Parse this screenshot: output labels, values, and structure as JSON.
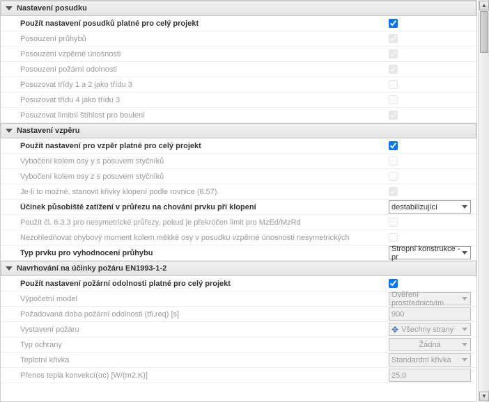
{
  "sections": [
    {
      "title": "Nastavení posudku",
      "rows": [
        {
          "label": "Použít nastavení posudků platné pro celý projekt",
          "type": "checkbox",
          "checked": true,
          "enabled": true,
          "bold": true
        },
        {
          "label": "Posouzení průhybů",
          "type": "checkbox",
          "checked": true,
          "enabled": false
        },
        {
          "label": "Posouzení vzpěrné únosnosti",
          "type": "checkbox",
          "checked": true,
          "enabled": false
        },
        {
          "label": "Posouzení požární odolnosti",
          "type": "checkbox",
          "checked": true,
          "enabled": false
        },
        {
          "label": "Posuzovat třídy 1 a 2 jako třídu 3",
          "type": "checkbox",
          "checked": false,
          "enabled": false
        },
        {
          "label": "Posuzovat třídu 4 jako třídu 3",
          "type": "checkbox",
          "checked": false,
          "enabled": false
        },
        {
          "label": "Posuzovat limitní štíhlost pro boulení",
          "type": "checkbox",
          "checked": true,
          "enabled": false
        }
      ]
    },
    {
      "title": "Nastavení vzpěru",
      "rows": [
        {
          "label": "Použít nastavení pro vzpěr platné pro celý projekt",
          "type": "checkbox",
          "checked": true,
          "enabled": true,
          "bold": true
        },
        {
          "label": "Vybočení kolem osy y s posuvem styčníků",
          "type": "checkbox",
          "checked": false,
          "enabled": false
        },
        {
          "label": "Vybočení kolem osy z s posuvem styčníků",
          "type": "checkbox",
          "checked": false,
          "enabled": false
        },
        {
          "label": "Je-li to možné, stanovit křivky klopení podle  rovnice (6.57).",
          "type": "checkbox",
          "checked": true,
          "enabled": false
        },
        {
          "label": "Účinek působiště zatížení  v průřezu na chování prvku při klopení",
          "type": "select",
          "value": "destabilizující",
          "enabled": true,
          "bold": true
        },
        {
          "label": "Použít čl. 6.3.3 pro nesymetrické průřezy, pokud je překročen limit pro MzEd/MzRd",
          "type": "checkbox",
          "checked": false,
          "enabled": false
        },
        {
          "label": "Nezohledňovat ohybový moment kolem měkké osy v posudku vzpěrné únosnosti nesymetrických",
          "type": "checkbox",
          "checked": false,
          "enabled": false
        },
        {
          "label": "Typ prvku pro vyhodnocení průhybu",
          "type": "select",
          "value": "Stropní konstrukce - pr",
          "enabled": true,
          "bold": true
        }
      ]
    },
    {
      "title": "Navrhování na účinky požáru EN1993-1-2",
      "rows": [
        {
          "label": "Použít nastavení požární odolnosti platné pro celý projekt",
          "type": "checkbox",
          "checked": true,
          "enabled": true,
          "bold": true
        },
        {
          "label": "Výpočetní model",
          "type": "select",
          "value": "Ověření prostřednictvím",
          "enabled": false
        },
        {
          "label": "Požadovaná doba požární odolnosti (tfi,req) [s]",
          "type": "text",
          "value": "900",
          "enabled": false
        },
        {
          "label": "Vystavení požáru",
          "type": "select-icon",
          "value": "Všechny strany",
          "enabled": false
        },
        {
          "label": "Typ ochrany",
          "type": "select",
          "value": "Žádná",
          "enabled": false,
          "centered": true
        },
        {
          "label": "Teplotní křivka",
          "type": "select",
          "value": "Standardní křivka",
          "enabled": false
        },
        {
          "label": "Přenos tepla konvekcí(αc) [W/(m2.K)]",
          "type": "text",
          "value": "25,0",
          "enabled": false
        }
      ]
    }
  ]
}
